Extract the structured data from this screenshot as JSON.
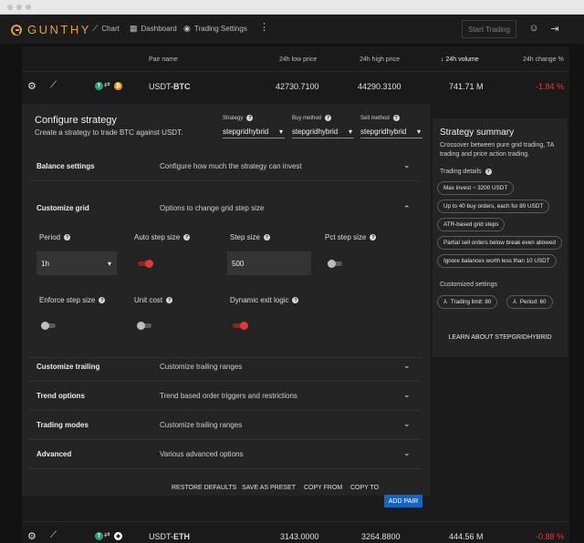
{
  "app": {
    "logo_text": "GUNTHY",
    "nav": [
      {
        "icon": "trend-line-icon",
        "label": "Chart"
      },
      {
        "icon": "dashboard-icon",
        "label": "Dashboard"
      },
      {
        "icon": "trading-settings-icon",
        "label": "Trading Settings"
      }
    ],
    "start_trading": "Start Trading"
  },
  "table": {
    "headers": {
      "pair": "Pair name",
      "low": "24h low price",
      "high": "24h high price",
      "volume": "↓ 24h volume",
      "change": "24h change %"
    },
    "rows": [
      {
        "pair_quote": "USDT-",
        "pair_base": "BTC",
        "low": "42730.7100",
        "high": "44290.3100",
        "volume": "741.71 M",
        "change": "-1.84 %"
      },
      {
        "pair_quote": "USDT-",
        "pair_base": "ETH",
        "low": "3143.0000",
        "high": "3264.8800",
        "volume": "444.56 M",
        "change": "-0.88 %"
      }
    ]
  },
  "config": {
    "title": "Configure strategy",
    "subtitle": "Create a strategy to trade BTC against USDT.",
    "strategy_label": "Strategy",
    "strategy_value": "stepgridhybrid",
    "buy_label": "Buy method",
    "buy_value": "stepgridhybrid",
    "sell_label": "Sell method",
    "sell_value": "stepgridhybrid",
    "sections": {
      "balance": {
        "title": "Balance settings",
        "desc": "Configure how much the strategy can invest"
      },
      "grid": {
        "title": "Customize grid",
        "desc": "Options to change grid step size"
      },
      "trailing": {
        "title": "Customize trailing",
        "desc": "Customize trailing ranges"
      },
      "trend": {
        "title": "Trend options",
        "desc": "Trend based order triggers and restrictions"
      },
      "modes": {
        "title": "Trading modes",
        "desc": "Customize trailing ranges"
      },
      "advanced": {
        "title": "Advanced",
        "desc": "Various advanced options"
      }
    },
    "grid_fields": {
      "period_label": "Period",
      "period_value": "1h",
      "auto_step_label": "Auto step size",
      "auto_step_on": true,
      "step_size_label": "Step size",
      "step_size_value": "500",
      "pct_step_label": "Pct step size",
      "pct_step_on": false,
      "enforce_label": "Enforce step size",
      "enforce_on": false,
      "unit_cost_label": "Unit cost",
      "unit_cost_on": false,
      "exit_logic_label": "Dynamic exit logic",
      "exit_logic_on": true
    },
    "buttons": {
      "restore": "RESTORE DEFAULTS",
      "save_preset": "SAVE AS PRESET",
      "copy_from": "COPY FROM",
      "copy_to": "COPY TO",
      "add_pair": "ADD PAIR"
    }
  },
  "summary": {
    "title": "Strategy summary",
    "desc": "Crossover between pure grid trading, TA trading and price action trading.",
    "details_label": "Trading details",
    "chips": [
      "Max invest ~ 3200 USDT",
      "Up to 40 buy orders, each for 80 USDT",
      "ATR-based grid steps",
      "Partial sell orders below break even allowed",
      "Ignore balances worth less than 10 USDT"
    ],
    "customized_label": "Customized settings",
    "custom_chips": [
      "Trading limit: 80",
      "Period: 60"
    ],
    "learn_more": "LEARN ABOUT STEPGRIDHYBRID"
  },
  "colors": {
    "accent": "#e0a23a",
    "negative": "#e53935",
    "primary_button": "#1565c0",
    "toggle_on": "#e53935"
  }
}
